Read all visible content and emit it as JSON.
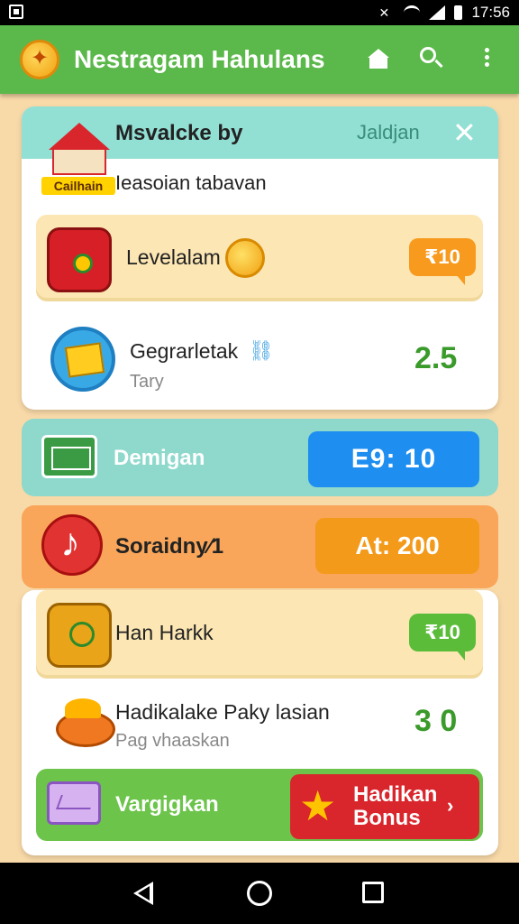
{
  "status_bar": {
    "time": "17:56"
  },
  "app_bar": {
    "title": "Nestragam Hahulans"
  },
  "card1": {
    "title": "Msvalcke by",
    "right_label": "Jaldjan",
    "close_glyph": "✕",
    "sign_text": "Cailhain",
    "subtitle": "Ieasoian tabavan",
    "level_row": {
      "label": "Levelalam",
      "pill": "₹10"
    },
    "geo_row": {
      "label": "Gegrarletak",
      "sub": "Tary",
      "value": "2.5"
    }
  },
  "band_teal": {
    "label": "Demigan",
    "button": "E9: 10"
  },
  "band_orange": {
    "label": "Soraidny∕1",
    "button": "At: 200"
  },
  "card2": {
    "han_row": {
      "label": "Han Harkk",
      "pill": "₹10"
    },
    "hadi_row": {
      "label": "Hadikalake Paky lasian",
      "sub": "Pag vhaaskan",
      "value": "3 0"
    },
    "vargi_row": {
      "label": "Vargigkan",
      "bonus_line1": "Hadikan",
      "bonus_line2": "Bonus",
      "bonus_chevron": "›"
    }
  },
  "colors": {
    "app_bar": "#5bb84a",
    "teal": "#8ed9cc",
    "orange": "#f9a65a",
    "blue_button": "#1e8ef0",
    "bonus_red": "#d8262c",
    "value_green": "#3a9a2a"
  },
  "icons": [
    "photo-icon",
    "mute-icon",
    "wifi-icon",
    "signal-icon",
    "battery-icon",
    "coin-logo-icon",
    "home-icon",
    "search-icon",
    "more-vert-icon",
    "close-icon",
    "house-icon",
    "red-box-icon",
    "gold-coin-icon",
    "crate-icon",
    "link-icon",
    "ticket-icon",
    "music-note-icon",
    "chest-icon",
    "pot-icon",
    "envelope-icon",
    "star-icon",
    "nav-back-icon",
    "nav-home-icon",
    "nav-recents-icon"
  ]
}
